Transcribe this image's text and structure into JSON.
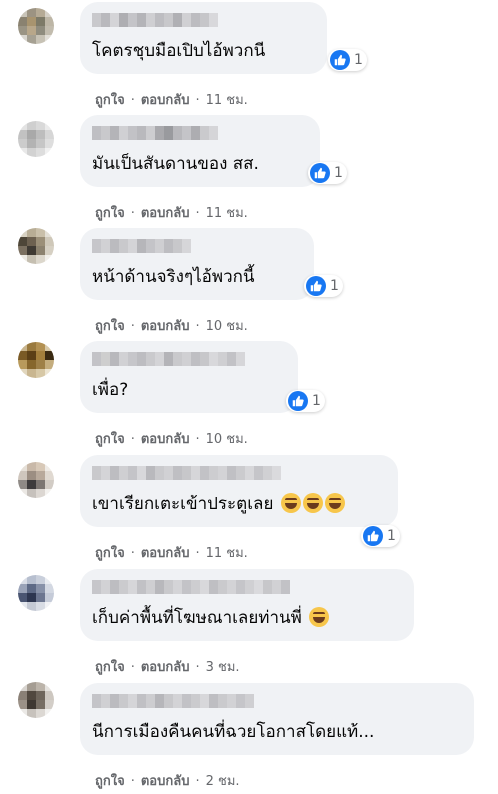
{
  "icons": {
    "like": "like-icon",
    "emoji": "grinning-sweat-emoji"
  },
  "colors": {
    "like": "#1877f2",
    "bubble": "#f0f2f5",
    "meta": "#65676b"
  },
  "comments": [
    {
      "text": "โคตรชุบมือเปิบไอ้พวกนี",
      "reactions": "1",
      "like_label": "ถูกใจ",
      "reply_label": "ตอบกลับ",
      "time": "11 ชม."
    },
    {
      "text": "มันเป็นสันดานของ สส.",
      "reactions": "1",
      "like_label": "ถูกใจ",
      "reply_label": "ตอบกลับ",
      "time": "11 ชม."
    },
    {
      "text": "หน้าด้านจริงๆไอ้พวกนี้",
      "reactions": "1",
      "like_label": "ถูกใจ",
      "reply_label": "ตอบกลับ",
      "time": "10 ชม."
    },
    {
      "text": "เพื่อ?",
      "reactions": "1",
      "like_label": "ถูกใจ",
      "reply_label": "ตอบกลับ",
      "time": "10 ชม."
    },
    {
      "text": "เขาเรียกเตะเข้าประตูเลย",
      "reactions": "1",
      "like_label": "ถูกใจ",
      "reply_label": "ตอบกลับ",
      "time": "11 ชม."
    },
    {
      "text": "เก็บค่าพื้นที่โฆษณาเลยท่านพี่",
      "reactions": "",
      "like_label": "ถูกใจ",
      "reply_label": "ตอบกลับ",
      "time": "3 ชม."
    },
    {
      "text": "นีการเมืองคืนคนที่ฉวยโอกาสโดยแท้...",
      "reactions": "",
      "like_label": "ถูกใจ",
      "reply_label": "ตอบกลับ",
      "time": "2 ชม."
    }
  ]
}
